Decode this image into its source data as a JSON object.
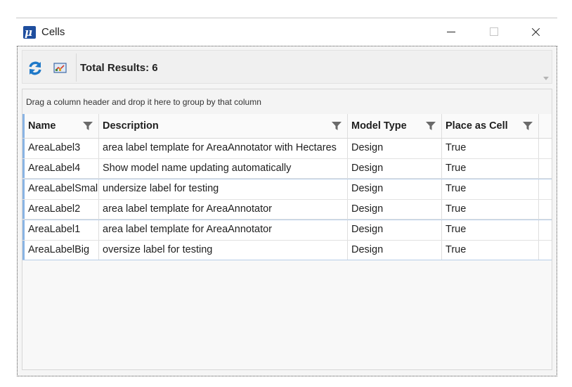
{
  "window": {
    "title": "Cells",
    "app_icon_letter": "μ"
  },
  "toolbar": {
    "total_results": "Total Results: 6"
  },
  "grid": {
    "group_panel_text": "Drag a column header and drop it here to group by that column",
    "columns": [
      "Name",
      "Description",
      "Model Type",
      "Place as Cell"
    ],
    "rows": [
      [
        "AreaLabel3",
        "area label template for AreaAnnotator with Hectares",
        "Design",
        "True"
      ],
      [
        "AreaLabel4",
        "Show model name updating automatically",
        "Design",
        "True"
      ],
      [
        "AreaLabelSmall",
        "undersize label for testing",
        "Design",
        "True"
      ],
      [
        "AreaLabel2",
        "area label template for AreaAnnotator",
        "Design",
        "True"
      ],
      [
        "AreaLabel1",
        "area label template for AreaAnnotator",
        "Design",
        "True"
      ],
      [
        "AreaLabelBig",
        "oversize label for testing",
        "Design",
        "True"
      ]
    ]
  },
  "colors": {
    "accent": "#1f4e9e",
    "selection_line": "#8ab4e4"
  }
}
